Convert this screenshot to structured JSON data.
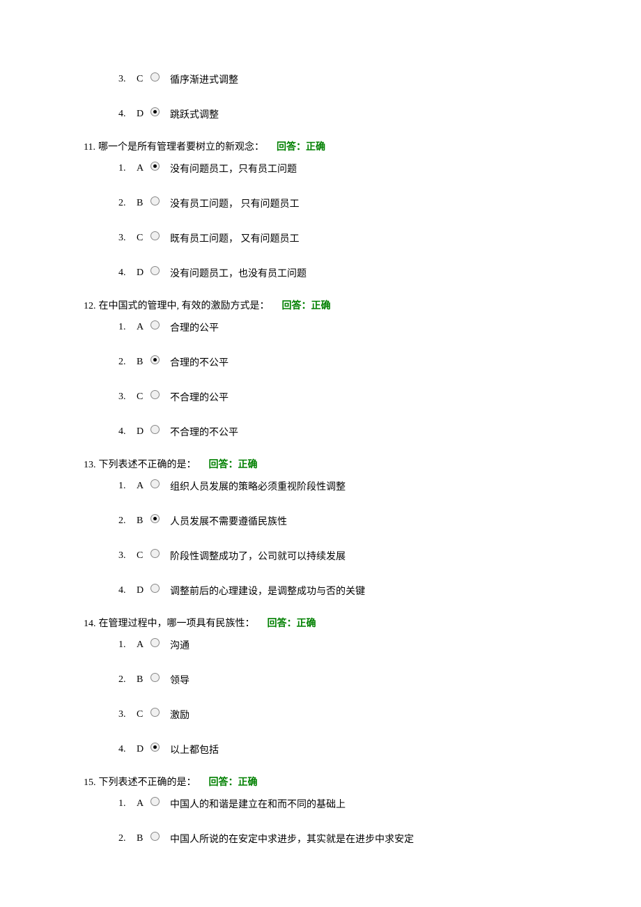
{
  "orphan_options": [
    {
      "index": "3.",
      "letter": "C",
      "selected": false,
      "text": "循序渐进式调整"
    },
    {
      "index": "4.",
      "letter": "D",
      "selected": true,
      "text": "跳跃式调整"
    }
  ],
  "questions": [
    {
      "number": "11.",
      "text": "哪一个是所有管理者要树立的新观念：",
      "feedback": "回答：正确",
      "options": [
        {
          "index": "1.",
          "letter": "A",
          "selected": true,
          "text": "没有问题员工，只有员工问题"
        },
        {
          "index": "2.",
          "letter": "B",
          "selected": false,
          "text": "没有员工问题， 只有问题员工"
        },
        {
          "index": "3.",
          "letter": "C",
          "selected": false,
          "text": "既有员工问题， 又有问题员工"
        },
        {
          "index": "4.",
          "letter": "D",
          "selected": false,
          "text": "没有问题员工，也没有员工问题"
        }
      ]
    },
    {
      "number": "12.",
      "text": "在中国式的管理中, 有效的激励方式是：",
      "feedback": "回答：正确",
      "options": [
        {
          "index": "1.",
          "letter": "A",
          "selected": false,
          "text": "合理的公平"
        },
        {
          "index": "2.",
          "letter": "B",
          "selected": true,
          "text": "合理的不公平"
        },
        {
          "index": "3.",
          "letter": "C",
          "selected": false,
          "text": "不合理的公平"
        },
        {
          "index": "4.",
          "letter": "D",
          "selected": false,
          "text": "不合理的不公平"
        }
      ]
    },
    {
      "number": "13.",
      "text": "下列表述不正确的是：",
      "feedback": "回答：正确",
      "options": [
        {
          "index": "1.",
          "letter": "A",
          "selected": false,
          "text": "组织人员发展的策略必须重视阶段性调整"
        },
        {
          "index": "2.",
          "letter": "B",
          "selected": true,
          "text": "人员发展不需要遵循民族性"
        },
        {
          "index": "3.",
          "letter": "C",
          "selected": false,
          "text": "阶段性调整成功了，公司就可以持续发展"
        },
        {
          "index": "4.",
          "letter": "D",
          "selected": false,
          "text": "调整前后的心理建设，是调整成功与否的关键"
        }
      ]
    },
    {
      "number": "14.",
      "text": "在管理过程中，哪一项具有民族性：",
      "feedback": "回答：正确",
      "options": [
        {
          "index": "1.",
          "letter": "A",
          "selected": false,
          "text": "沟通"
        },
        {
          "index": "2.",
          "letter": "B",
          "selected": false,
          "text": "领导"
        },
        {
          "index": "3.",
          "letter": "C",
          "selected": false,
          "text": "激励"
        },
        {
          "index": "4.",
          "letter": "D",
          "selected": true,
          "text": "以上都包括"
        }
      ]
    },
    {
      "number": "15.",
      "text": "下列表述不正确的是：",
      "feedback": "回答：正确",
      "options": [
        {
          "index": "1.",
          "letter": "A",
          "selected": false,
          "text": "中国人的和谐是建立在和而不同的基础上"
        },
        {
          "index": "2.",
          "letter": "B",
          "selected": false,
          "text": "中国人所说的在安定中求进步，其实就是在进步中求安定"
        }
      ]
    }
  ]
}
